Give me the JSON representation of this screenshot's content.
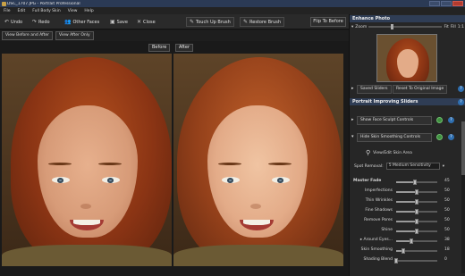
{
  "window": {
    "title": "DSC_1707.JPG - Portrait Professional"
  },
  "menu": [
    "File",
    "Edit",
    "Full Body Skin",
    "View",
    "Help"
  ],
  "toolbar": {
    "undo": "Undo",
    "redo": "Redo",
    "other_faces": "Other Faces",
    "save": "Save",
    "close": "Close",
    "touch_up": "Touch Up Brush",
    "restore": "Restore Brush",
    "flip": "Flip To Before"
  },
  "view_tabs": {
    "before_after": "View Before and After",
    "after_only": "View After Only"
  },
  "panes": {
    "before": "Before",
    "after": "After"
  },
  "panel": {
    "enhance_title": "Enhance Photo",
    "zoom_label": "Zoom",
    "fit": "Fit",
    "fill": "Fill",
    "one_to_one": "1:1",
    "saved_sliders": "Saved Sliders",
    "reset": "Reset To Original Image",
    "improving_title": "Portrait Improving Sliders",
    "face_sculpt": "Show Face Sculpt Controls",
    "skin_smoothing": "Hide Skin Smoothing Controls",
    "view_skin": "View/Edit Skin Area",
    "spot_label": "Spot Removal:",
    "spot_value": "5 Medium Sensitivity",
    "help": "?"
  },
  "sliders": [
    {
      "label": "Master Fade",
      "value": 45,
      "bold": true
    },
    {
      "label": "Imperfections",
      "value": 50
    },
    {
      "label": "Thin Wrinkles",
      "value": 50
    },
    {
      "label": "Fine Shadows",
      "value": 50
    },
    {
      "label": "Remove Pores",
      "value": 50
    },
    {
      "label": "Shine",
      "value": 50
    },
    {
      "label": "Around Eyes...",
      "value": 38,
      "expander": true
    },
    {
      "label": "Skin Smoothing",
      "value": 18
    },
    {
      "label": "Shading Blend",
      "value": 0
    }
  ]
}
